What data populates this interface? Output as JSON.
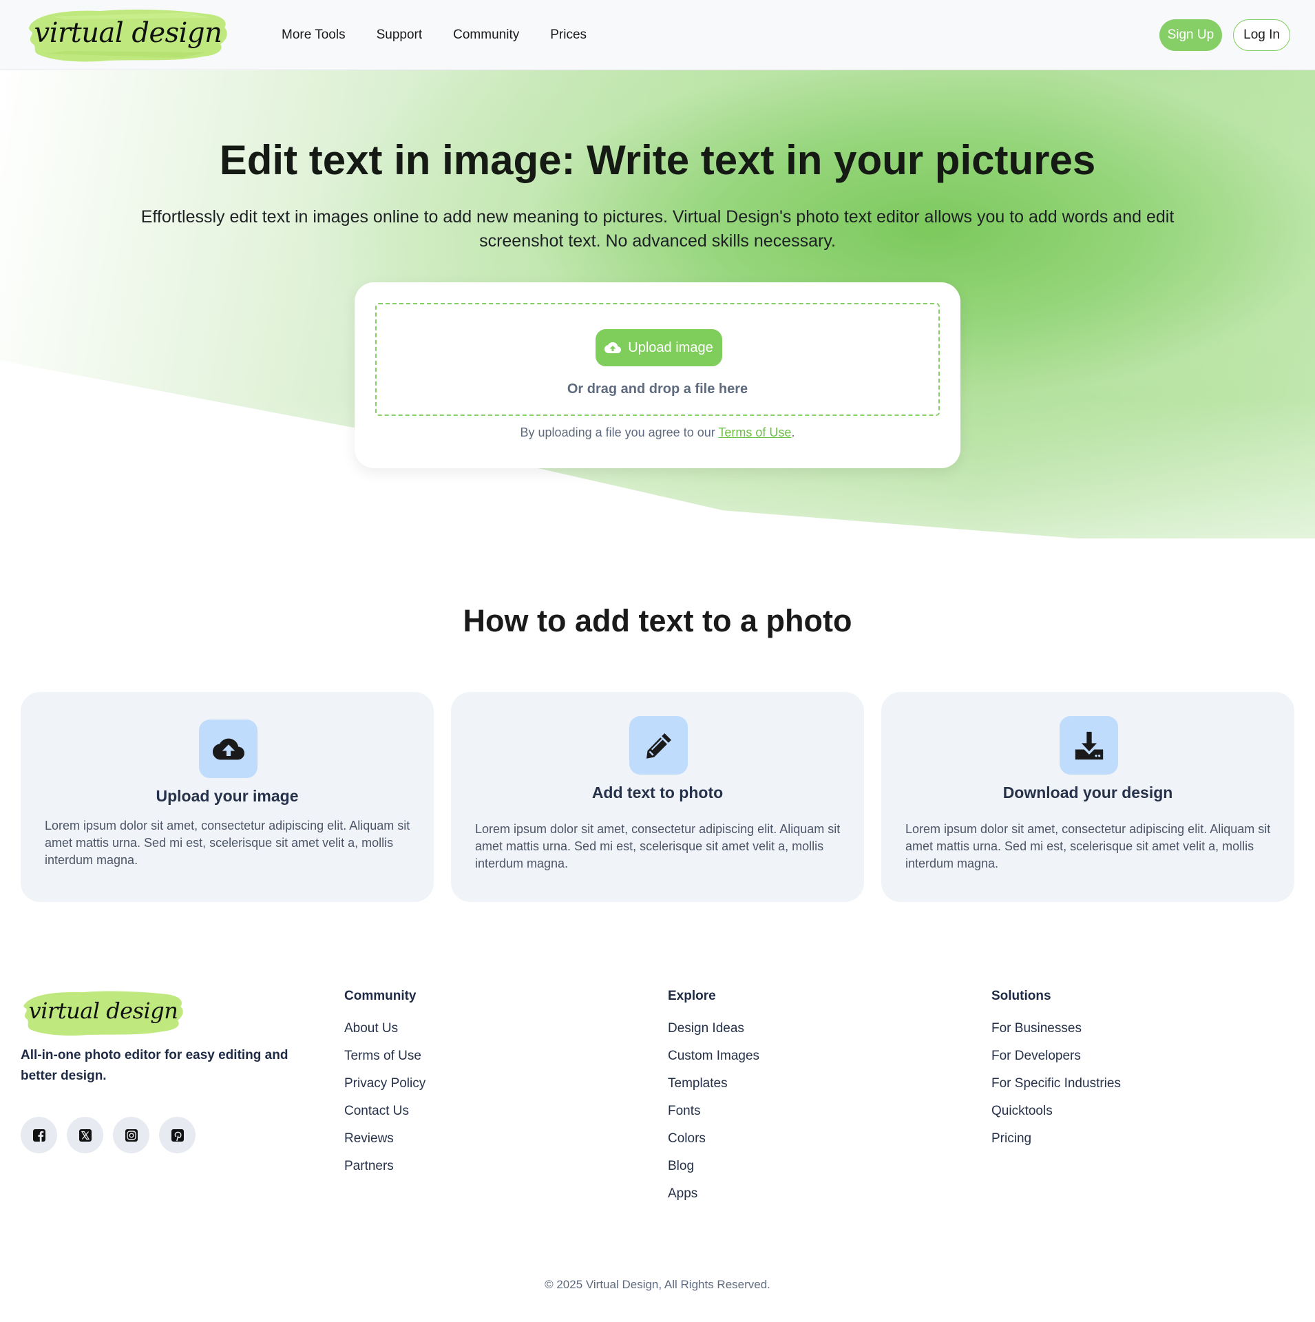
{
  "header": {
    "logo_text": "virtual design",
    "nav": [
      "More Tools",
      "Support",
      "Community",
      "Prices"
    ],
    "signup_label": "Sign Up",
    "login_label": "Log In"
  },
  "hero": {
    "title": "Edit text in image: Write text in your pictures",
    "subtitle": "Effortlessly edit text in images online to add new meaning to pictures. Virtual Design's photo text editor allows you to add words and edit screenshot text. No advanced skills necessary.",
    "upload_label": "Upload image",
    "upload_icon": "cloud-upload-icon",
    "drag_text": "Or drag and drop a file here",
    "agree_prefix": "By uploading a file you agree to our ",
    "terms_link": "Terms of Use",
    "agree_suffix": "."
  },
  "how": {
    "title": "How to add text to a photo",
    "steps": [
      {
        "icon": "cloud-upload-icon",
        "title": "Upload your image",
        "text": "Lorem ipsum dolor sit amet, consectetur adipiscing elit. Aliquam sit amet mattis urna. Sed mi est, scelerisque sit amet velit a, mollis interdum magna."
      },
      {
        "icon": "pencil-icon",
        "title": "Add text to photo",
        "text": "Lorem ipsum dolor sit amet, consectetur adipiscing elit. Aliquam sit amet mattis urna. Sed mi est, scelerisque sit amet velit a, mollis interdum magna."
      },
      {
        "icon": "download-icon",
        "title": "Download your design",
        "text": "Lorem ipsum dolor sit amet, consectetur adipiscing elit. Aliquam sit amet mattis urna. Sed mi est, scelerisque sit amet velit a, mollis interdum magna."
      }
    ]
  },
  "footer": {
    "logo_text": "virtual design",
    "tagline": "All-in-one photo editor for easy editing and better design.",
    "socials": [
      "facebook-icon",
      "x-icon",
      "instagram-icon",
      "pinterest-icon"
    ],
    "columns": [
      {
        "title": "Community",
        "links": [
          "About Us",
          "Terms of Use",
          "Privacy Policy",
          "Contact Us",
          "Reviews",
          "Partners"
        ]
      },
      {
        "title": "Explore",
        "links": [
          "Design Ideas",
          "Custom Images",
          "Templates",
          "Fonts",
          "Colors",
          "Blog",
          "Apps"
        ]
      },
      {
        "title": "Solutions",
        "links": [
          "For Businesses",
          "For Developers",
          "For Specific Industries",
          "Quicktools",
          "Pricing"
        ]
      }
    ],
    "copyright": "© 2025 Virtual Design, All Rights Reserved."
  },
  "colors": {
    "accent": "#86cf66",
    "icon_tile": "#bfdcfd",
    "card_bg": "#f0f3f8"
  }
}
